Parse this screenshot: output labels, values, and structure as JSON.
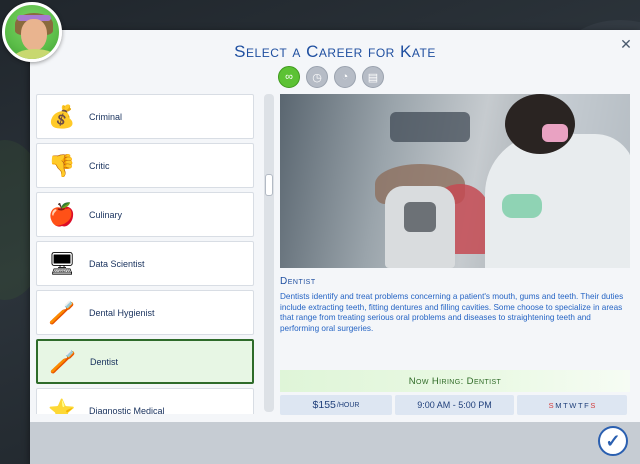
{
  "dialog": {
    "title": "Select a Career for Kate",
    "close_glyph": "✕",
    "confirm_glyph": "✓"
  },
  "toolbar": [
    {
      "icon": "infinity-icon",
      "glyph": "∞",
      "active": true
    },
    {
      "icon": "briefcase-clock-icon",
      "glyph": "◷",
      "active": false
    },
    {
      "icon": "clock-icon",
      "glyph": "◔",
      "active": false
    },
    {
      "icon": "folder-icon",
      "glyph": "▤",
      "active": false
    }
  ],
  "careers": [
    {
      "label": "Criminal",
      "icon": "money-case-icon",
      "glyph": "💰",
      "selected": false
    },
    {
      "label": "Critic",
      "icon": "thumbs-icon",
      "glyph": "👎",
      "selected": false
    },
    {
      "label": "Culinary",
      "icon": "cooking-icon",
      "glyph": "🍎",
      "selected": false
    },
    {
      "label": "Data Scientist",
      "icon": "computer-icon",
      "glyph": "🖥",
      "selected": false
    },
    {
      "label": "Dental Hygienist",
      "icon": "toothbrush-icon",
      "glyph": "🪥",
      "selected": false
    },
    {
      "label": "Dentist",
      "icon": "toothbrush-icon",
      "glyph": "🪥",
      "selected": true
    },
    {
      "label": "Diagnostic Medical",
      "icon": "star-icon",
      "glyph": "⭐",
      "selected": false
    }
  ],
  "details": {
    "name": "Dentist",
    "description": "Dentists identify and treat problems concerning a patient's mouth, gums and teeth. Their duties include extracting teeth, fitting dentures and filling cavities. Some choose to specialize in areas that range from treating serious oral problems and diseases to straightening teeth and performing oral surgeries.",
    "hiring": "Now Hiring: Dentist",
    "salary_amount": "$155",
    "salary_unit": "/HOUR",
    "hours": "9:00 AM - 5:00 PM",
    "days": [
      {
        "letter": "S",
        "works": false
      },
      {
        "letter": "M",
        "works": true
      },
      {
        "letter": "T",
        "works": true
      },
      {
        "letter": "W",
        "works": true
      },
      {
        "letter": "T",
        "works": true
      },
      {
        "letter": "F",
        "works": true
      },
      {
        "letter": "S",
        "works": false
      }
    ]
  },
  "colors": {
    "title": "#1f4fa0",
    "selected_border": "#2e6b2a",
    "active_filter": "#5cc234",
    "off_day": "#d23a3a"
  },
  "list_scroll": 0.3
}
